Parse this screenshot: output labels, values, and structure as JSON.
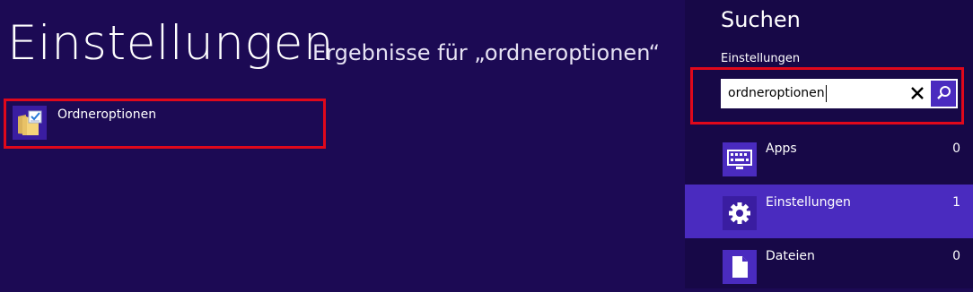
{
  "main": {
    "title": "Einstellungen",
    "results_label": "Ergebnisse für „ordneroptionen“",
    "results": [
      {
        "label": "Ordneroptionen",
        "icon": "folder-options-icon"
      }
    ]
  },
  "search_pane": {
    "title": "Suchen",
    "scope_label": "Einstellungen",
    "query": "ordneroptionen",
    "clear_icon": "close-icon",
    "search_icon": "search-icon",
    "categories": [
      {
        "label": "Apps",
        "count": "0",
        "icon": "apps-keyboard-icon",
        "selected": false
      },
      {
        "label": "Einstellungen",
        "count": "1",
        "icon": "gear-icon",
        "selected": true
      },
      {
        "label": "Dateien",
        "count": "0",
        "icon": "document-icon",
        "selected": false
      }
    ]
  },
  "colors": {
    "background": "#1c0a54",
    "pane_background": "#170847",
    "accent": "#4a2bbf",
    "highlight_outline": "#e0081b"
  }
}
